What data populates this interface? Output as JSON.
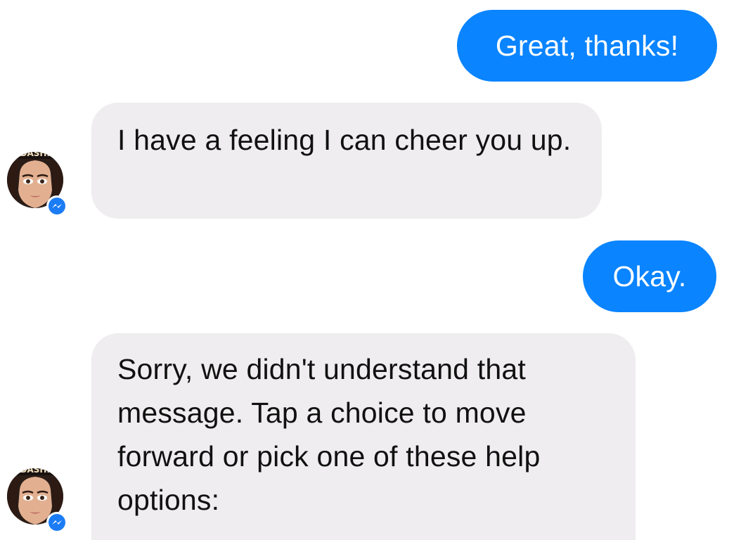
{
  "conversation": {
    "messages": [
      {
        "direction": "outgoing",
        "text": "Great, thanks!"
      },
      {
        "direction": "incoming",
        "text": "I have a feeling I can cheer you up."
      },
      {
        "direction": "outgoing",
        "text": "Okay."
      },
      {
        "direction": "incoming",
        "text": "Sorry, we didn't understand that message. Tap a choice to move forward or pick one of these help options:"
      }
    ],
    "bot_avatar": {
      "banner_text": "ARDASHIA",
      "badge_icon": "messenger-icon"
    }
  },
  "colors": {
    "outgoing_bubble": "#0a84ff",
    "incoming_bubble": "#efedef",
    "badge": "#1b7cf5"
  }
}
